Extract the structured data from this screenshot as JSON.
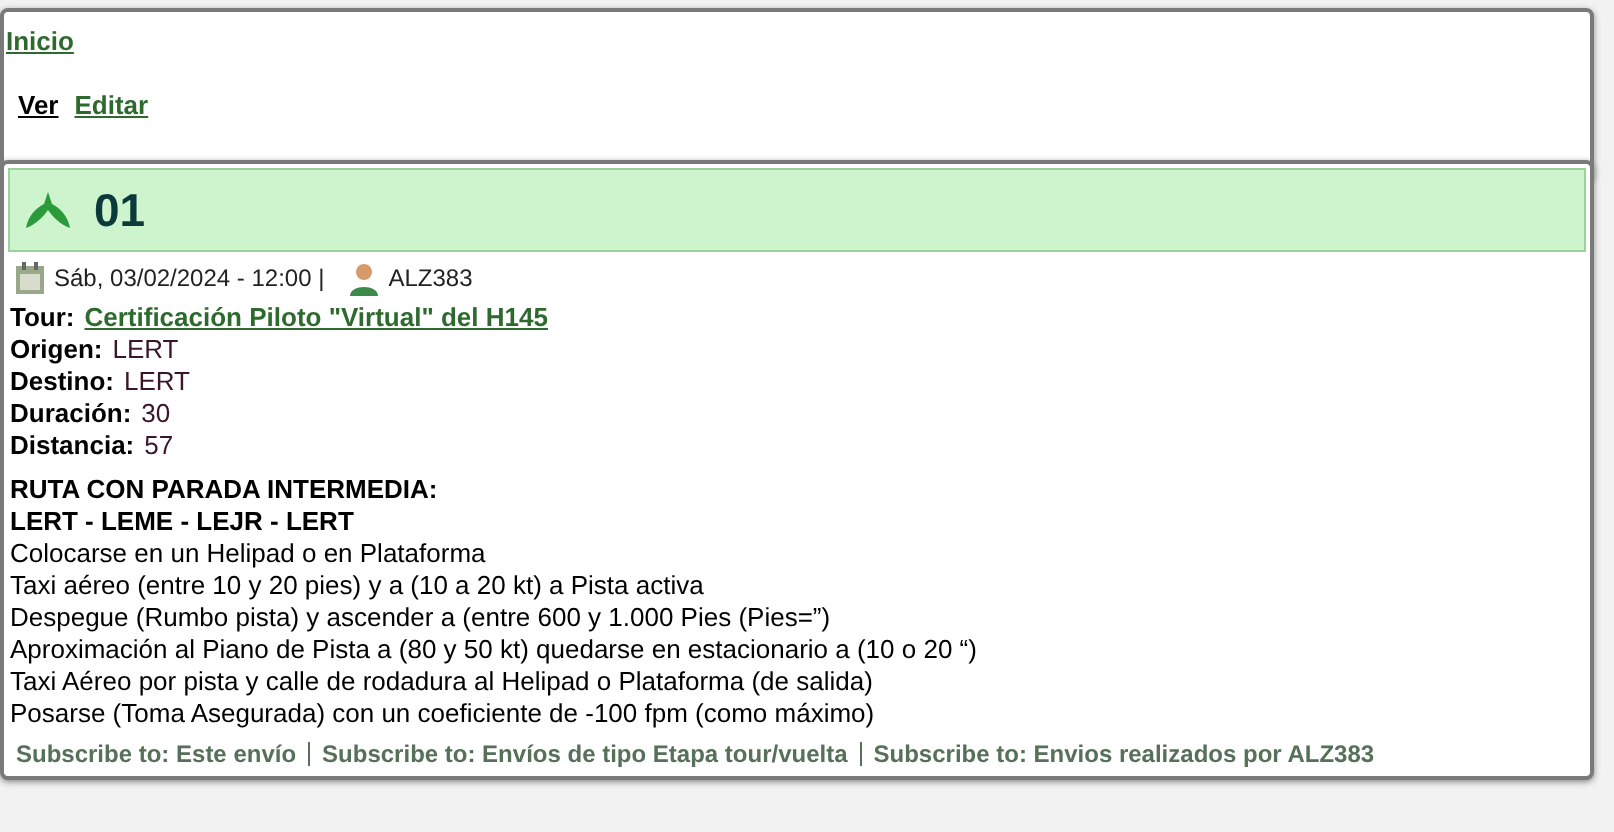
{
  "breadcrumb": "Inicio",
  "tabs": [
    {
      "label": "Ver",
      "selected": true
    },
    {
      "label": "Editar",
      "selected": false
    }
  ],
  "node": {
    "title": "01",
    "date": "Sáb, 03/02/2024 - 12:00 |",
    "author": "ALZ383",
    "tour": {
      "label": "Tour:",
      "value": "Certificación Piloto \"Virtual\" del H145"
    },
    "fields": [
      {
        "label": "Origen:",
        "value": "LERT"
      },
      {
        "label": "Destino:",
        "value": "LERT"
      },
      {
        "label": "Duración:",
        "value": "30"
      },
      {
        "label": "Distancia:",
        "value": "57"
      }
    ],
    "heading": [
      "RUTA CON PARADA INTERMEDIA:",
      "LERT - LEME - LEJR - LERT"
    ],
    "steps": [
      "Colocarse en un Helipad o en Plataforma",
      "Taxi aéreo (entre 10 y 20 pies) y a (10 a 20 kt) a Pista activa",
      "Despegue (Rumbo pista) y ascender a (entre 600 y 1.000 Pies (Pies=”)",
      "Aproximación al Piano de Pista a (80 y 50 kt) quedarse en estacionario a (10 o 20 “)",
      "Taxi Aéreo por pista y calle de rodadura al Helipad o Plataforma (de salida)",
      "Posarse (Toma Asegurada) con un coeficiente de -100 fpm (como máximo)"
    ],
    "subscribe": [
      "Subscribe to: Este envío",
      "Subscribe to: Envíos de tipo Etapa tour/vuelta",
      "Subscribe to: Envios realizados por ALZ383"
    ]
  }
}
